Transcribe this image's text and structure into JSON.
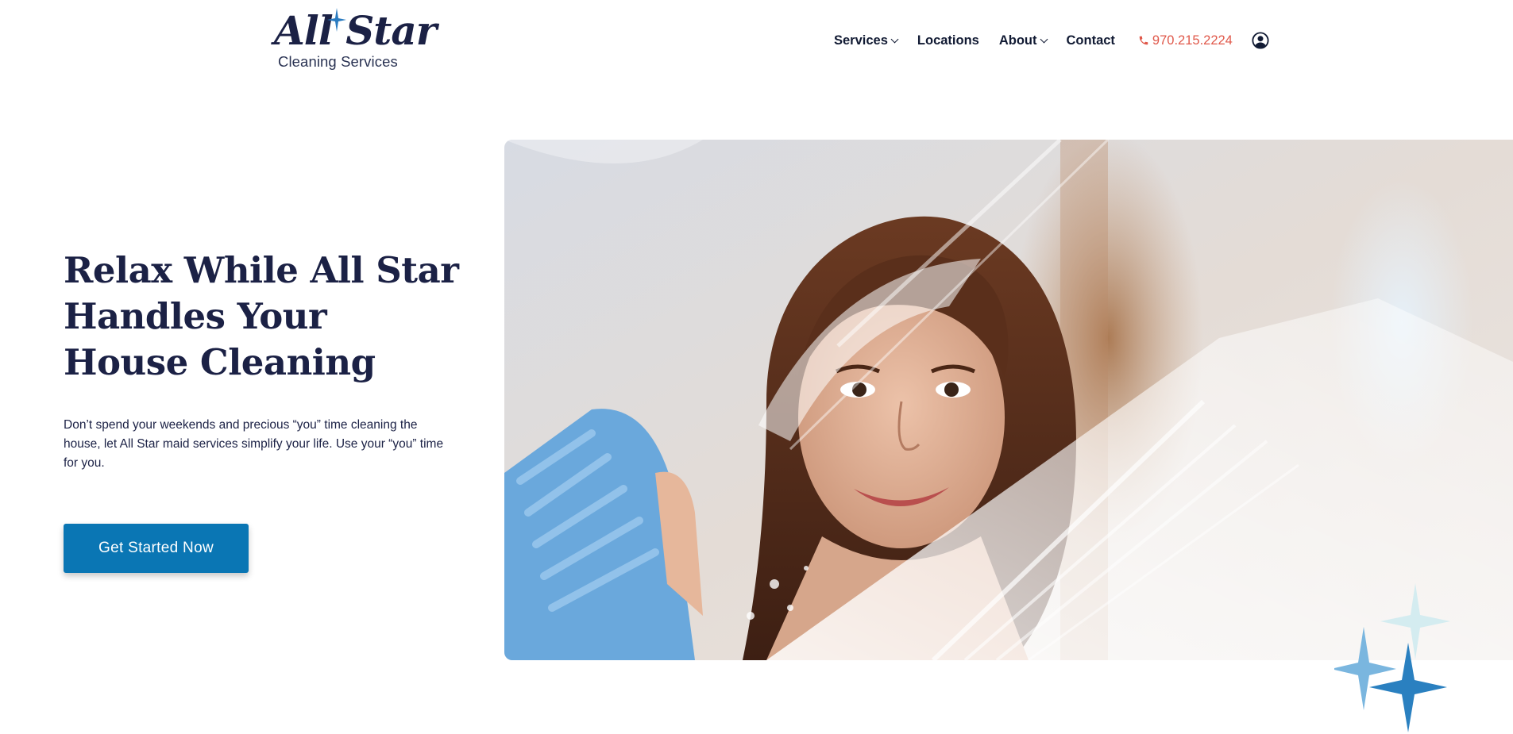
{
  "brand": {
    "logo_main": "All Star",
    "logo_sub": "Cleaning Services",
    "accent_color": "#0a76b4",
    "navy_color": "#1b2145",
    "phone_color": "#e0584a"
  },
  "nav": {
    "items": [
      {
        "label": "Services",
        "has_dropdown": true
      },
      {
        "label": "Locations",
        "has_dropdown": false
      },
      {
        "label": "About",
        "has_dropdown": true
      },
      {
        "label": "Contact",
        "has_dropdown": false
      }
    ],
    "phone": "970.215.2224",
    "phone_icon": "phone-icon",
    "account_icon": "account-icon"
  },
  "hero": {
    "title": "Relax While All Star Handles Your House Cleaning",
    "text": "Don’t spend your weekends and precious “you” time cleaning the house, let All Star maid services simplify your life. Use your “you” time for you.",
    "cta_label": "Get Started Now",
    "image_icon": "woman-cleaning-mirror-photo",
    "decoration_icon": "sparkles-icon"
  }
}
